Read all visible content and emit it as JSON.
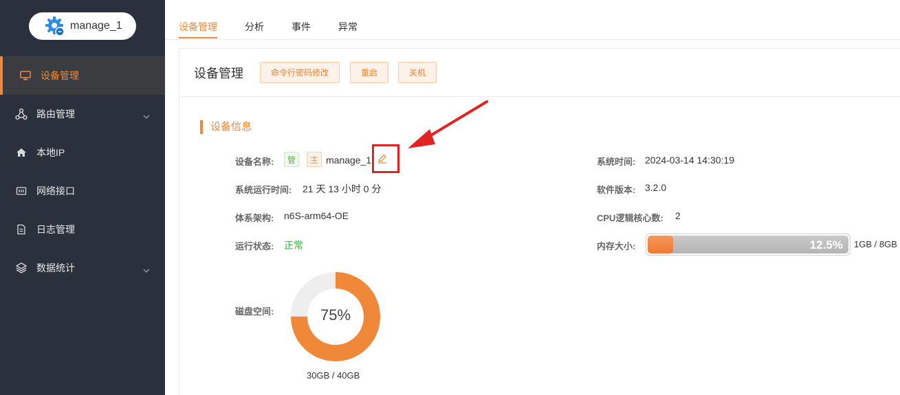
{
  "device": {
    "name": "manage_1"
  },
  "sidebar": {
    "items": [
      {
        "label": "设备管理",
        "icon": "monitor-icon",
        "active": true
      },
      {
        "label": "路由管理",
        "icon": "topology-icon",
        "expandable": true
      },
      {
        "label": "本地IP",
        "icon": "home-icon"
      },
      {
        "label": "网络接口",
        "icon": "network-port-icon"
      },
      {
        "label": "日志管理",
        "icon": "document-icon"
      },
      {
        "label": "数据统计",
        "icon": "layers-icon",
        "expandable": true
      }
    ]
  },
  "tabs": [
    {
      "label": "设备管理",
      "active": true
    },
    {
      "label": "分析"
    },
    {
      "label": "事件"
    },
    {
      "label": "异常"
    }
  ],
  "card": {
    "title": "设备管理",
    "buttons": {
      "cli_password": "命令行密码修改",
      "reboot": "重启",
      "shutdown": "关机"
    }
  },
  "info": {
    "section_title": "设备信息",
    "device_name_label": "设备名称:",
    "tag_manage": "管",
    "tag_master": "主",
    "device_name_value": "manage_1",
    "uptime_label": "系统运行时间:",
    "uptime_value": "21 天 13 小时 0 分",
    "arch_label": "体系架构:",
    "arch_value": "n6S-arm64-OE",
    "status_label": "运行状态:",
    "status_value": "正常",
    "disk_label": "磁盘空间:",
    "disk_percent": "75%",
    "disk_percent_value": 75,
    "disk_size": "30GB / 40GB",
    "systime_label": "系统时间:",
    "systime_value": "2024-03-14 14:30:19",
    "version_label": "软件版本:",
    "version_value": "3.2.0",
    "cpu_label": "CPU逻辑核心数:",
    "cpu_value": "2",
    "mem_label": "内存大小:",
    "mem_percent": "12.5%",
    "mem_percent_value": 12.5,
    "mem_size": "1GB / 8GB"
  },
  "colors": {
    "accent": "#f0883a",
    "sidebar_bg": "#2b313c",
    "status_ok": "#3cb44b",
    "highlight": "#e02424"
  }
}
